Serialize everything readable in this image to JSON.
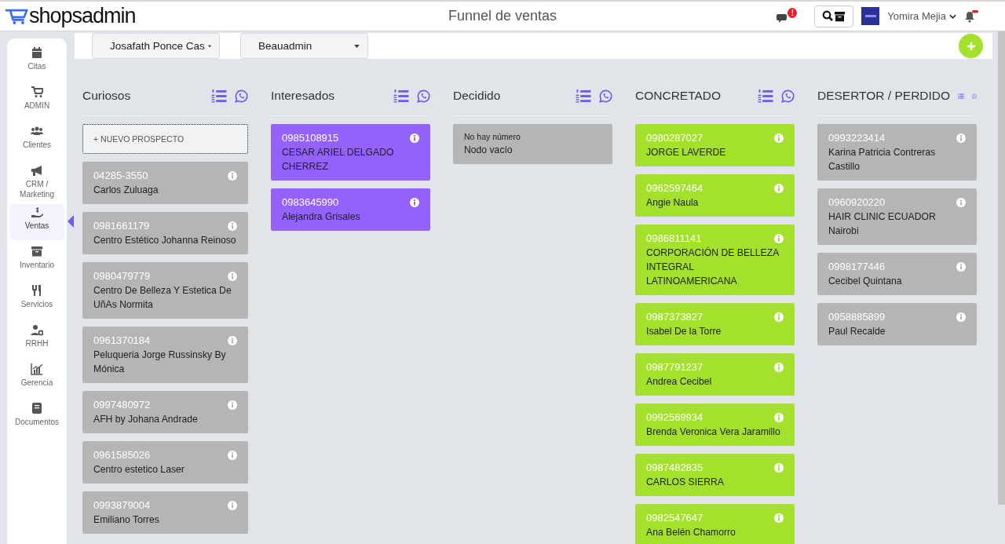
{
  "header": {
    "logo": "shopsadmin",
    "title": "Funnel de ventas",
    "chat_badge": "!",
    "user": "Yomira Mejia"
  },
  "sidebar": {
    "items": [
      {
        "label": "Citas",
        "selected": false
      },
      {
        "label": "ADMIN",
        "selected": false
      },
      {
        "label": "Clientes",
        "selected": false
      },
      {
        "label": "CRM / Marketing",
        "selected": false
      },
      {
        "label": "Ventas",
        "selected": true
      },
      {
        "label": "Inventario",
        "selected": false
      },
      {
        "label": "Servicios",
        "selected": false
      },
      {
        "label": "RRHH",
        "selected": false
      },
      {
        "label": "Gerencia",
        "selected": false
      },
      {
        "label": "Documentos",
        "selected": false
      }
    ]
  },
  "toolbar": {
    "dropdowns": [
      "Josafath Ponce Cas",
      "Beauadmin"
    ]
  },
  "columns": [
    {
      "title": "Curiosos",
      "color": "#b5b5b5",
      "new_button": "+ NUEVO PROSPECTO",
      "cards": [
        {
          "kind": "lead",
          "number": "04285-3550",
          "name": "Carlos Zuluaga"
        },
        {
          "kind": "lead",
          "number": "0981661179",
          "name": "Centro Estético Johanna Reinoso"
        },
        {
          "kind": "lead",
          "number": "0980479779",
          "name": "Centro De Belleza Y Estetica De UñAs Normita"
        },
        {
          "kind": "lead",
          "number": "0961370184",
          "name": "Peluqueria Jorge Russinsky By Mónica"
        },
        {
          "kind": "lead",
          "number": "0997480972",
          "name": "AFH by Johana Andrade"
        },
        {
          "kind": "lead",
          "number": "0961585026",
          "name": "Centro estetico Laser"
        },
        {
          "kind": "lead",
          "number": "0993879004",
          "name": "Emiliano Torres"
        }
      ]
    },
    {
      "title": "Interesados",
      "color": "#9461fb",
      "cards": [
        {
          "kind": "lead",
          "number": "0985108915",
          "name": "CESAR ARIEL DELGADO CHERREZ"
        },
        {
          "kind": "lead",
          "number": "0983645990",
          "name": "Alejandra Grisales"
        }
      ]
    },
    {
      "title": "Decidido",
      "color": "#b5b5b5",
      "cards": [
        {
          "kind": "empty",
          "number": "No hay número",
          "name": "Nodo vacío"
        }
      ]
    },
    {
      "title": "CONCRETADO",
      "color": "#a3e12d",
      "cards": [
        {
          "kind": "lead",
          "number": "0980287027",
          "name": "JORGE LAVERDE"
        },
        {
          "kind": "lead",
          "number": "0962597464",
          "name": "Angie Naula"
        },
        {
          "kind": "lead",
          "number": "0986811141",
          "name": "CORPORACIÓN DE BELLEZA INTEGRAL LATINOAMERICANA"
        },
        {
          "kind": "lead",
          "number": "0987373827",
          "name": "Isabel De la Torre"
        },
        {
          "kind": "lead",
          "number": "0987791237",
          "name": "Andrea Cecibel"
        },
        {
          "kind": "lead",
          "number": "0992569934",
          "name": "Brenda Veronica Vera Jaramillo"
        },
        {
          "kind": "lead",
          "number": "0987482835",
          "name": "CARLOS SIERRA"
        },
        {
          "kind": "lead",
          "number": "0982547647",
          "name": "Ana Belén Chamorro"
        }
      ]
    },
    {
      "title": "DESERTOR / PERDIDO",
      "color": "#b5b5b5",
      "cards": [
        {
          "kind": "lead",
          "number": "0993223414",
          "name": "Karina Patricia Contreras Castillo"
        },
        {
          "kind": "lead",
          "number": "0960920220",
          "name": "HAIR CLINIC ECUADOR Nairobi"
        },
        {
          "kind": "lead",
          "number": "0998177446",
          "name": "Cecibel Quintana"
        },
        {
          "kind": "lead",
          "number": "0958885899",
          "name": "Paul Recalde"
        }
      ]
    }
  ]
}
